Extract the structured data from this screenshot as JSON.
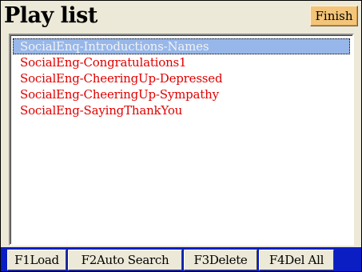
{
  "window": {
    "title": "Play list",
    "finish_label": "Finish"
  },
  "playlist": {
    "items": [
      {
        "label": "SocialEnq-Introductions-Names",
        "selected": true
      },
      {
        "label": "SocialEng-Congratulations1",
        "selected": false
      },
      {
        "label": "SocialEng-CheeringUp-Depressed",
        "selected": false
      },
      {
        "label": "SocialEng-CheeringUp-Sympathy",
        "selected": false
      },
      {
        "label": "SocialEng-SayingThankYou",
        "selected": false
      }
    ]
  },
  "function_bar": {
    "f1": "F1Load",
    "f2": "F2Auto Search",
    "f3": "F3Delete",
    "f4": "F4Del All"
  },
  "colors": {
    "item_text": "#e00000",
    "selection_bg": "#97b7ea",
    "function_bar_bg": "#0a1ec4",
    "finish_button_bg": "#f3c57a"
  }
}
